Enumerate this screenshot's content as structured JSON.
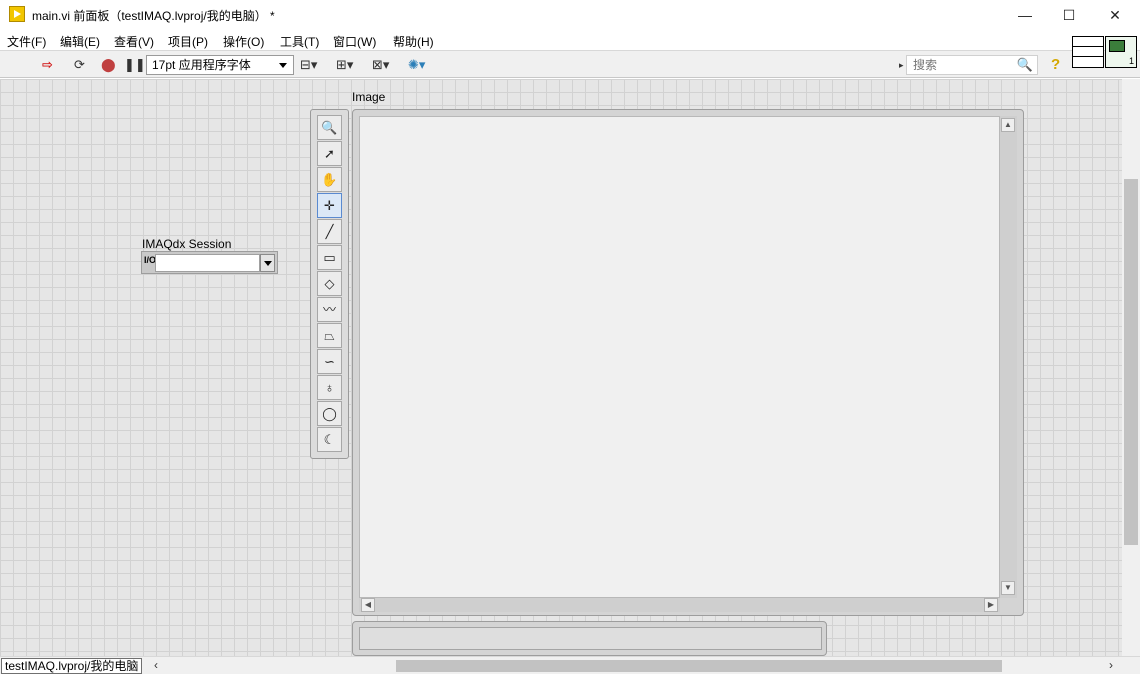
{
  "window": {
    "title": "main.vi 前面板（testIMAQ.lvproj/我的电脑） *",
    "minimize": "—",
    "maximize": "☐",
    "close": "✕"
  },
  "menu": [
    "文件(F)",
    "编辑(E)",
    "查看(V)",
    "项目(P)",
    "操作(O)",
    "工具(T)",
    "窗口(W)",
    "帮助(H)"
  ],
  "toolbar": {
    "font": "17pt 应用程序字体",
    "search_placeholder": "搜索",
    "search_arrow": "▸",
    "search_icon": "🔍",
    "help": "?",
    "vi_icon_number": "1"
  },
  "controls": {
    "session_label": "IMAQdx Session",
    "session_io": "I/O",
    "image_label": "Image"
  },
  "palette_tools": [
    {
      "name": "zoom-tool-icon",
      "glyph": "🔍"
    },
    {
      "name": "selection-arrow-icon",
      "glyph": "➚"
    },
    {
      "name": "pan-hand-icon",
      "glyph": "✋"
    },
    {
      "name": "point-crosshair-icon",
      "glyph": "✛"
    },
    {
      "name": "line-tool-icon",
      "glyph": "╱"
    },
    {
      "name": "rectangle-tool-icon",
      "glyph": "▭"
    },
    {
      "name": "rotated-rectangle-icon",
      "glyph": "◇"
    },
    {
      "name": "polyline-tool-icon",
      "glyph": "〰"
    },
    {
      "name": "polygon-tool-icon",
      "glyph": "⏢"
    },
    {
      "name": "freehand-line-icon",
      "glyph": "∽"
    },
    {
      "name": "freehand-region-icon",
      "glyph": "♁"
    },
    {
      "name": "oval-tool-icon",
      "glyph": "◯"
    },
    {
      "name": "annulus-tool-icon",
      "glyph": "☾"
    }
  ],
  "status": {
    "path": "testIMAQ.lvproj/我的电脑"
  },
  "colors": {
    "canvas": "#e6e6e6",
    "grid": "#d2d2d2",
    "active_tool": "#dbe8f7"
  }
}
